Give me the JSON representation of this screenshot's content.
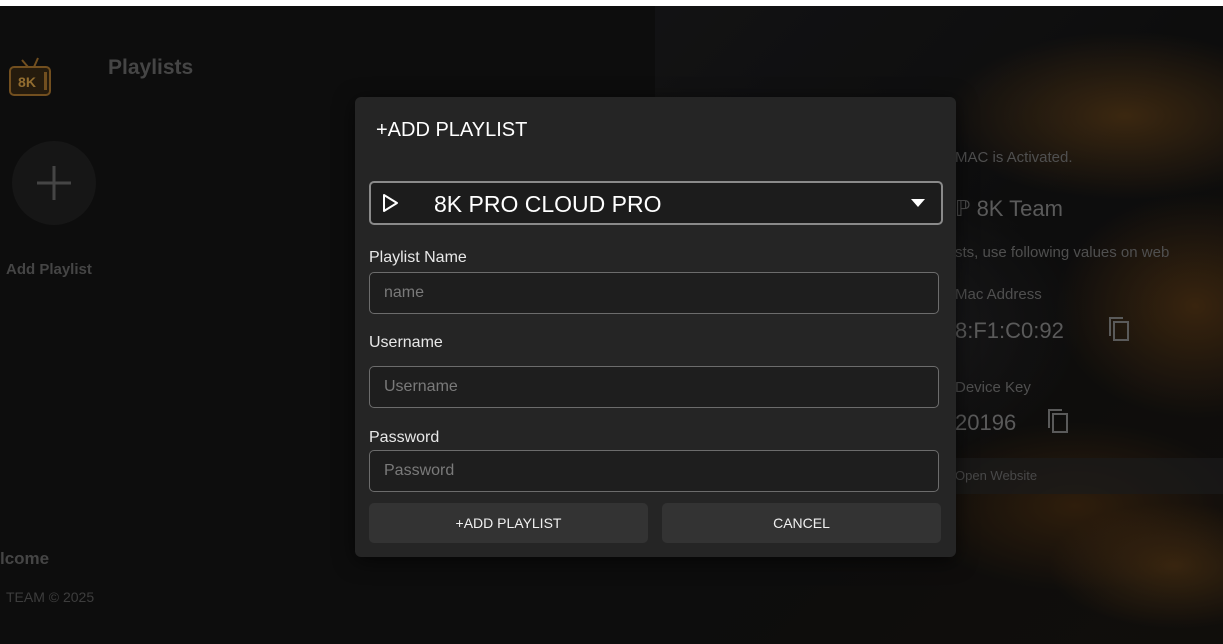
{
  "app": {
    "page_title": "Playlists",
    "logo_text": "8K"
  },
  "left": {
    "add_label": "Add Playlist",
    "welcome": "lcome",
    "copyright": "TEAM © 2025"
  },
  "right": {
    "activated": "MAC is Activated.",
    "team": "8K Team",
    "instructions": "sts, use following values on web",
    "mac_label": "Mac Address",
    "mac_value": "8:F1:C0:92",
    "device_key_label": "Device Key",
    "device_key_value": "20196",
    "open_website": "Open Website"
  },
  "modal": {
    "title": "+ADD PLAYLIST",
    "select": {
      "selected": "8K PRO CLOUD PRO"
    },
    "fields": {
      "playlist_name": {
        "label": "Playlist Name",
        "placeholder": "name"
      },
      "username": {
        "label": "Username",
        "placeholder": "Username"
      },
      "password": {
        "label": "Password",
        "placeholder": "Password"
      }
    },
    "add_button": "+ADD PLAYLIST",
    "cancel_button": "CANCEL"
  },
  "colors": {
    "background": "#151515",
    "modal": "#252525",
    "button": "#333333",
    "accent_art": "#9a6020"
  }
}
